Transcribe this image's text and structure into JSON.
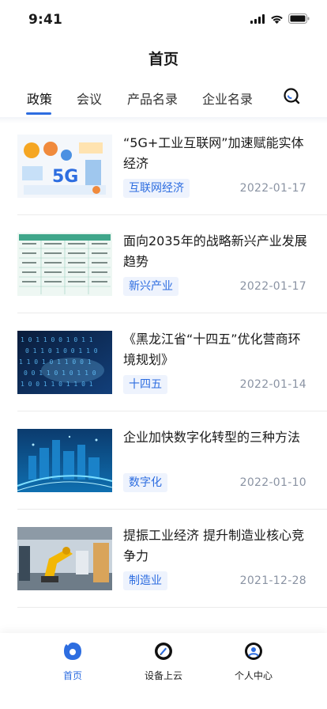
{
  "status": {
    "time": "9:41"
  },
  "header": {
    "title": "首页"
  },
  "tabs": [
    {
      "label": "政策",
      "active": true
    },
    {
      "label": "会议",
      "active": false
    },
    {
      "label": "产品名录",
      "active": false
    },
    {
      "label": "企业名录",
      "active": false
    }
  ],
  "articles": [
    {
      "title": "“5G+工业互联网”加速赋能实体经济",
      "tag": "互联网经济",
      "date": "2022-01-17",
      "thumb": "5g-infographic"
    },
    {
      "title": "面向2035年的战略新兴产业发展趋势",
      "tag": "新兴产业",
      "date": "2022-01-17",
      "thumb": "strategy-table"
    },
    {
      "title": "《黑龙江省“十四五”优化营商环境规划》",
      "tag": "十四五",
      "date": "2022-01-14",
      "thumb": "binary-code"
    },
    {
      "title": "企业加快数字化转型的三种方法",
      "tag": "数字化",
      "date": "2022-01-10",
      "thumb": "digital-city"
    },
    {
      "title": "提振工业经济 提升制造业核心竞争力",
      "tag": "制造业",
      "date": "2021-12-28",
      "thumb": "robot-arm"
    }
  ],
  "bottom_nav": [
    {
      "label": "首页",
      "icon": "home-icon",
      "active": true
    },
    {
      "label": "设备上云",
      "icon": "cloud-device-icon",
      "active": false
    },
    {
      "label": "个人中心",
      "icon": "profile-icon",
      "active": false
    }
  ],
  "colors": {
    "accent": "#2d6de0",
    "tag_bg": "#eef3fd",
    "date": "#8a93a3"
  }
}
